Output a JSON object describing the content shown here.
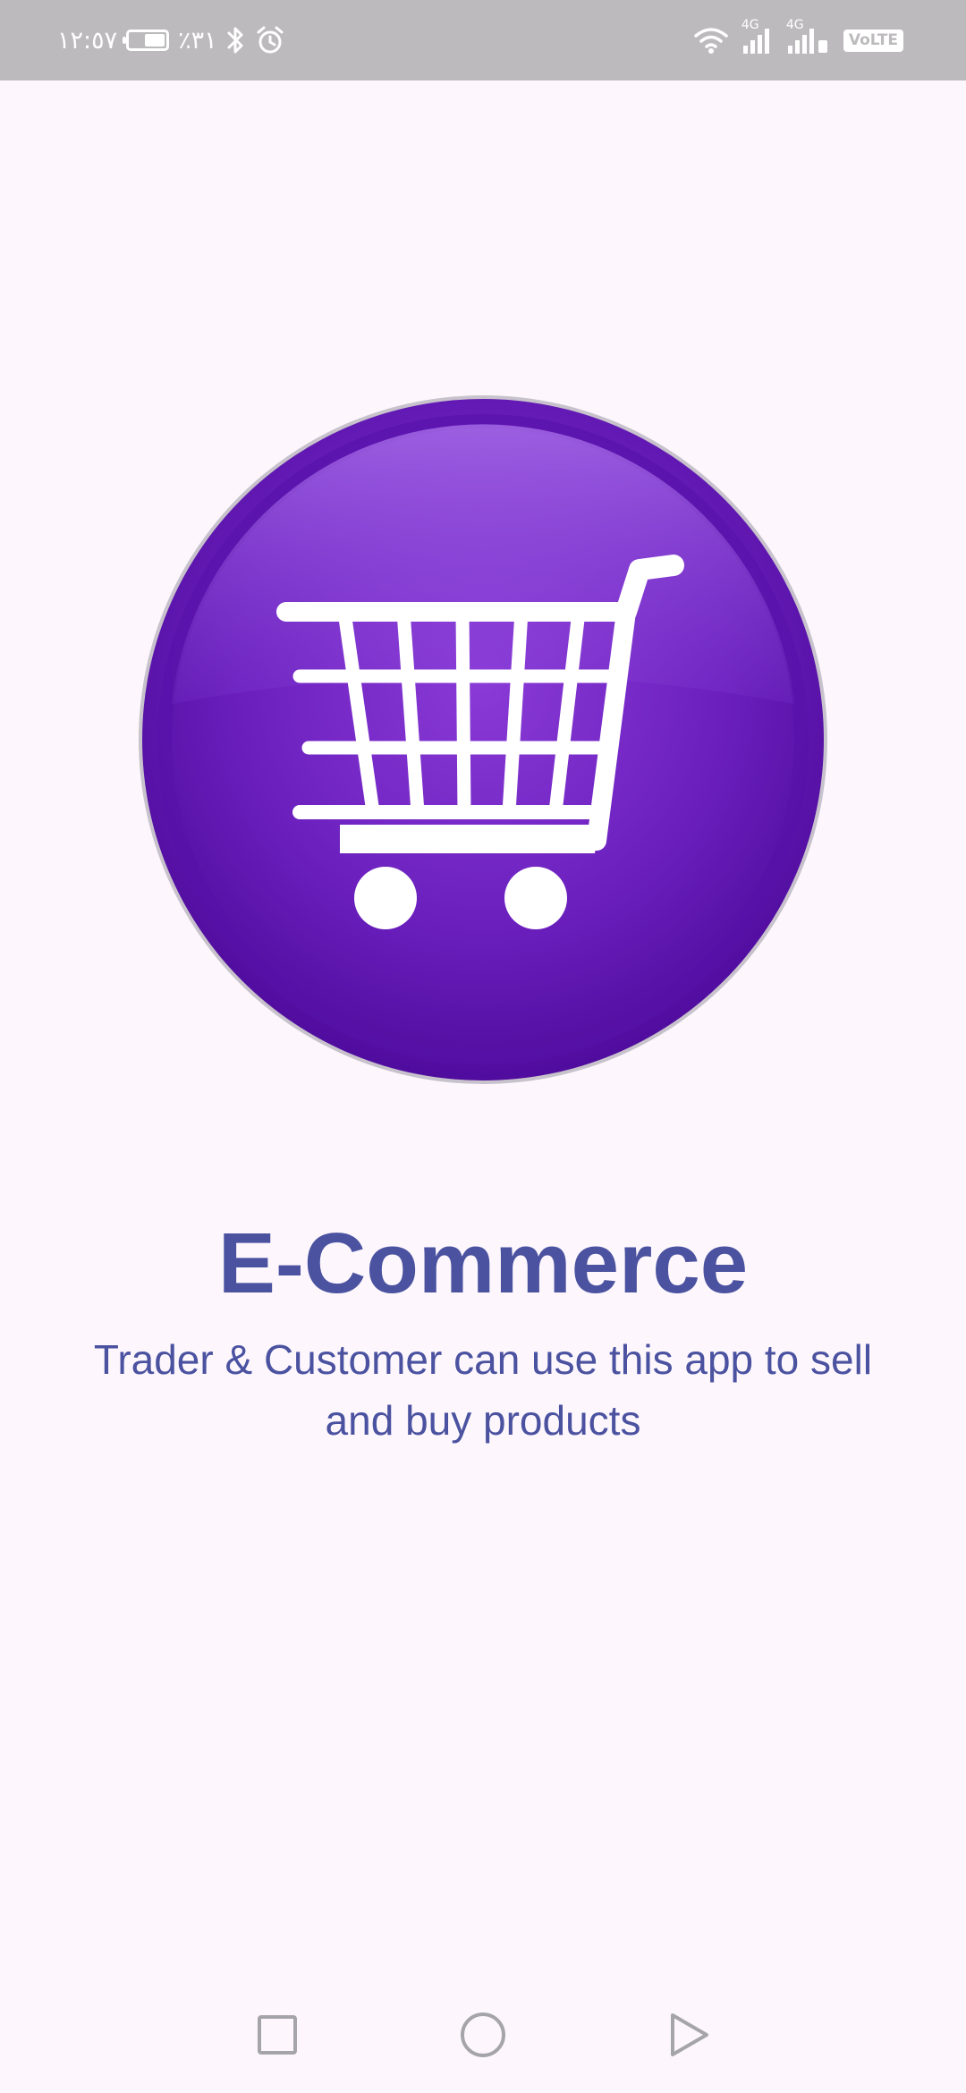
{
  "status_bar": {
    "time": "١٢:٥٧",
    "battery_percent_text": "٪٣١",
    "battery_level": 0.31,
    "network_1": "4G",
    "network_2": "4G",
    "volte": "VoLTE"
  },
  "splash": {
    "logo_icon": "shopping-cart-icon",
    "title": "E-Commerce",
    "description": "Trader & Customer can use this app to sell and buy products"
  },
  "nav_bar": {
    "recents_icon": "square-icon",
    "home_icon": "circle-icon",
    "back_icon": "triangle-icon"
  },
  "colors": {
    "background": "#fdf7fd",
    "status_bar": "#bdbabd",
    "accent_text": "#4b52a0",
    "logo_purple": "#7a2fcc",
    "logo_purple_dark": "#5a14a8"
  }
}
